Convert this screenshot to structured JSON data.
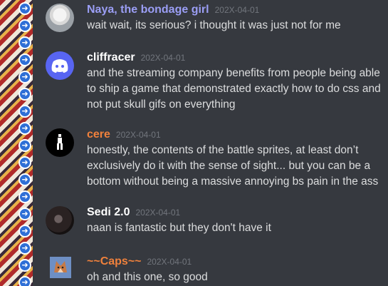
{
  "messages": [
    {
      "username": "Naya, the bondage girl",
      "username_color": "#9b9ef5",
      "timestamp": "202X-04-01",
      "text": "wait wait, its serious? i thought it was just not for me",
      "avatar_icon": "anime-avatar-icon"
    },
    {
      "username": "cliffracer",
      "username_color": "#ffffff",
      "timestamp": "202X-04-01",
      "text": "and the streaming company benefits from people being able to ship a game that demonstrated exactly how to do css and not put skull gifs on everything",
      "avatar_icon": "discord-logo-icon"
    },
    {
      "username": "cere",
      "username_color": "#f0813c",
      "timestamp": "202X-04-01",
      "text": "honestly, the contents of the battle sprites, at least don’t exclusively do it with the sense of sight... but you can be a bottom without being a massive annoying bs pain in the ass",
      "avatar_icon": "pixel-figure-icon"
    },
    {
      "username": "Sedi 2.0",
      "username_color": "#ffffff",
      "timestamp": "202X-04-01",
      "text": "naan is fantastic but they don't have it",
      "avatar_icon": "dark-photo-avatar-icon"
    },
    {
      "username": "~~Caps~~",
      "username_color": "#f0813c",
      "timestamp": "202X-04-01",
      "text": "oh and this one, so good",
      "avatar_icon": "fox-avatar-icon"
    }
  ]
}
